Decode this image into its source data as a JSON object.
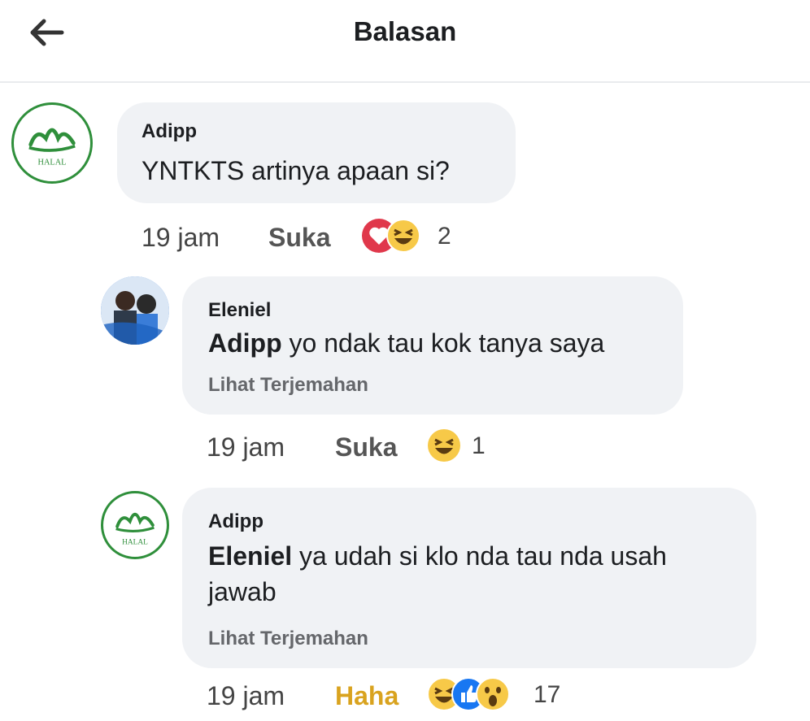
{
  "header": {
    "title": "Balasan",
    "back_icon": "arrow-left-icon"
  },
  "colors": {
    "bubble": "#f0f2f5",
    "halal_green": "#2f8f3b",
    "haha_yellow": "#d9a31f",
    "love_red": "#e0384b",
    "like_blue": "#1877f2"
  },
  "comments": [
    {
      "author": "Adipp",
      "avatar": "halal-logo",
      "avatar_text": "HALAL",
      "text": "YNTKTS artinya apaan si?",
      "time": "19 jam",
      "action": "Suka",
      "reactions": [
        "love-icon",
        "haha-icon"
      ],
      "reaction_count": "2"
    },
    {
      "author": "Eleniel",
      "avatar": "couple-photo",
      "mention": "Adipp",
      "text": " yo ndak tau kok tanya saya",
      "translate": "Lihat Terjemahan",
      "time": "19 jam",
      "action": "Suka",
      "reactions": [
        "haha-icon"
      ],
      "reaction_count": "1"
    },
    {
      "author": "Adipp",
      "avatar": "halal-logo",
      "avatar_text": "HALAL",
      "mention": "Eleniel",
      "text_line1": " ya udah si klo nda tau nda usah",
      "text_line2": "jawab",
      "translate": "Lihat Terjemahan",
      "time": "19 jam",
      "action": "Haha",
      "reactions": [
        "haha-icon",
        "like-icon",
        "wow-icon"
      ],
      "reaction_count": "17"
    }
  ]
}
